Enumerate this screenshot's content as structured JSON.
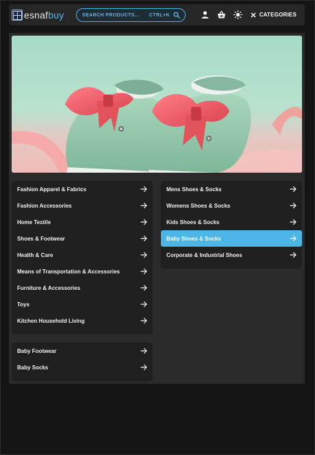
{
  "header": {
    "logo_prefix": "esnaf",
    "logo_suffix": "buy",
    "search_placeholder": "SEARCH PRODUCTS...",
    "search_shortcut": "CTRL+K",
    "categories_label": "CATEGORIES"
  },
  "menu": {
    "main_categories": [
      {
        "label": "Fashion Apparel & Fabrics"
      },
      {
        "label": "Fashion Accessories"
      },
      {
        "label": "Home Textile"
      },
      {
        "label": "Shoes & Footwear"
      },
      {
        "label": "Health & Care"
      },
      {
        "label": "Means of Transportation & Accessories"
      },
      {
        "label": "Furniture & Accessories"
      },
      {
        "label": "Toys"
      },
      {
        "label": "Kitchen Household Living"
      }
    ],
    "sub_categories": [
      {
        "label": "Mens Shoes & Socks"
      },
      {
        "label": "Womens Shoes & Socks"
      },
      {
        "label": "Kids Shoes & Socks"
      },
      {
        "label": "Baby Shoes & Socks",
        "active": true
      },
      {
        "label": "Corporate & Industrial Shoes"
      }
    ],
    "leaf_categories": [
      {
        "label": "Baby Footwear"
      },
      {
        "label": "Baby Socks"
      }
    ]
  },
  "colors": {
    "accent": "#4bb6e6",
    "panel": "#2a2a2a",
    "menu_bg": "#1f1f1f"
  }
}
